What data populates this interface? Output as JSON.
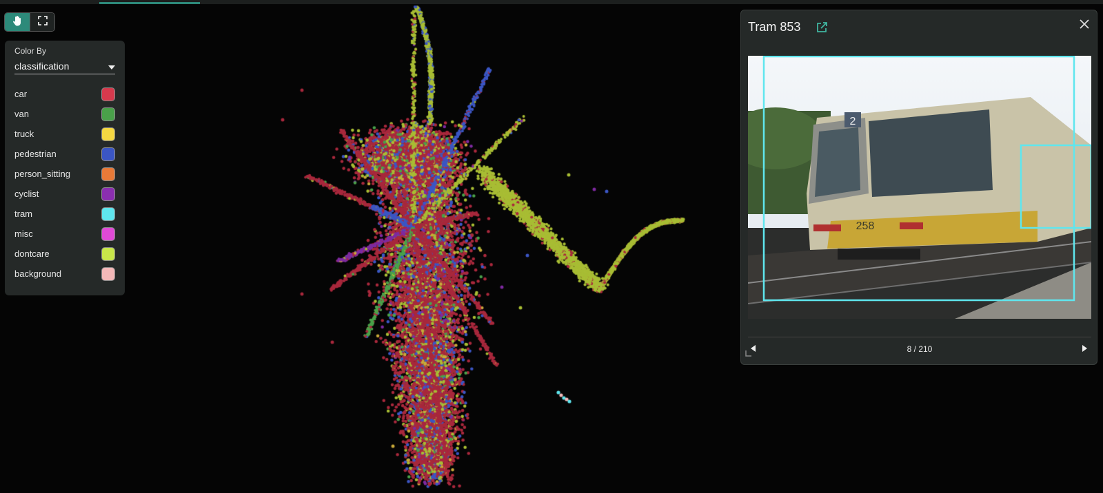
{
  "toolbar": {
    "pan_icon": "hand-icon",
    "fullscreen_icon": "fullscreen-icon",
    "accent": "#2d8a7a"
  },
  "legend": {
    "color_by_label": "Color By",
    "color_by_value": "classification",
    "classes": [
      {
        "label": "car",
        "color": "#d63a4d"
      },
      {
        "label": "van",
        "color": "#4aa14a"
      },
      {
        "label": "truck",
        "color": "#f5d842"
      },
      {
        "label": "pedestrian",
        "color": "#3b56c4"
      },
      {
        "label": "person_sitting",
        "color": "#e87a38"
      },
      {
        "label": "cyclist",
        "color": "#8b2fb0"
      },
      {
        "label": "tram",
        "color": "#5fe6ee"
      },
      {
        "label": "misc",
        "color": "#e04ad6"
      },
      {
        "label": "dontcare",
        "color": "#c8e64a"
      },
      {
        "label": "background",
        "color": "#f4b8b8"
      }
    ]
  },
  "sample_panel": {
    "title": "Tram 853",
    "counter": "8 / 210",
    "tram_number": "258",
    "route_number": "2",
    "bbox_color": "#5fe6ee"
  }
}
